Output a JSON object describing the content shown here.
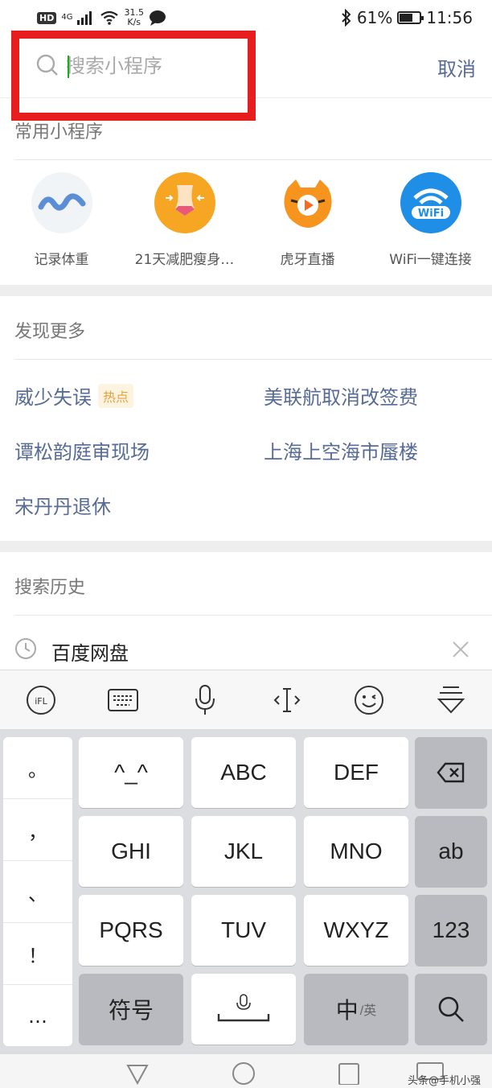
{
  "status_bar": {
    "hd": "HD",
    "network": "4G",
    "speed_value": "31.5",
    "speed_unit": "K/s",
    "battery": "61%",
    "battery_level": 0.61,
    "time": "11:56"
  },
  "search": {
    "placeholder": "搜索小程序",
    "cancel_label": "取消"
  },
  "frequent": {
    "title": "常用小程序",
    "apps": [
      {
        "label": "记录体重",
        "icon": "wave-icon"
      },
      {
        "label": "21天减肥瘦身…",
        "icon": "slim-waist-icon"
      },
      {
        "label": "虎牙直播",
        "icon": "tiger-play-icon"
      },
      {
        "label": "WiFi一键连接",
        "icon": "wifi-icon"
      }
    ]
  },
  "discover": {
    "title": "发现更多",
    "items": [
      {
        "text": "威少失误",
        "badge": "热点"
      },
      {
        "text": "美联航取消改签费"
      },
      {
        "text": "谭松韵庭审现场"
      },
      {
        "text": "上海上空海市蜃楼"
      },
      {
        "text": "宋丹丹退休"
      }
    ]
  },
  "history": {
    "title": "搜索历史",
    "items": [
      {
        "text": "百度网盘"
      }
    ]
  },
  "keyboard": {
    "toolbar": [
      "logo-icon",
      "keyboard-icon",
      "mic-icon",
      "cursor-icon",
      "emoji-icon",
      "collapse-icon"
    ],
    "punctuation": [
      "。",
      "，",
      "、",
      "！",
      "…"
    ],
    "row1": [
      "^_^",
      "ABC",
      "DEF"
    ],
    "row2": [
      "GHI",
      "JKL",
      "MNO",
      "ab"
    ],
    "row3": [
      "PQRS",
      "TUV",
      "WXYZ",
      "123"
    ],
    "row4": {
      "symbols": "符号",
      "lang_main": "中",
      "lang_sub": "/英"
    }
  },
  "nav_bar": {
    "watermark": "头条@手机小强"
  },
  "colors": {
    "highlight": "#e81d1d",
    "link": "#576b95",
    "caret": "#1aad19",
    "badge_text": "#e6a23c"
  }
}
